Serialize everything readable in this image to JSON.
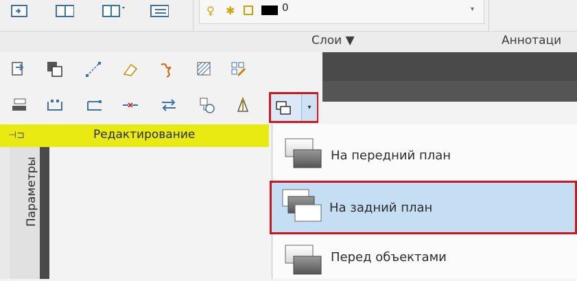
{
  "ribbon": {
    "layers_panel_label": "Слои ▼",
    "annotation_panel_label": "Аннотаци",
    "layer_combo_value": "0"
  },
  "modify_panel": {
    "title": "Редактирование"
  },
  "palette": {
    "vertical_tab_label": "Параметры"
  },
  "draw_order_menu": {
    "items": [
      {
        "label": "На передний план",
        "icon": "bring-to-front-icon"
      },
      {
        "label": "На задний план",
        "icon": "send-to-back-icon"
      },
      {
        "label": "Перед объектами",
        "icon": "bring-above-objects-icon"
      }
    ]
  },
  "colors": {
    "highlight_red": "#d0161d",
    "menu_selected_bg": "#c5def4",
    "panel_yellow": "#e8ea11",
    "drawing_dark": "#4a4a4a"
  }
}
